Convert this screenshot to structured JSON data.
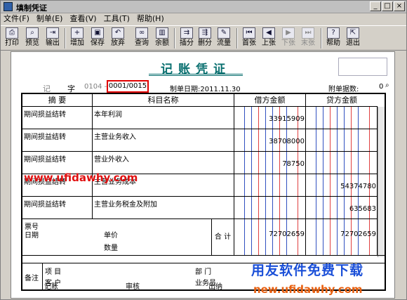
{
  "window": {
    "title": "填制凭证",
    "min": "_",
    "max": "□",
    "close": "×"
  },
  "menu": [
    "文件(F)",
    "制单(E)",
    "查看(V)",
    "工具(T)",
    "帮助(H)"
  ],
  "toolbar": {
    "print": "打印",
    "preview": "预览",
    "export": "输出",
    "add": "增加",
    "save": "保存",
    "discard": "放弃",
    "query": "查询",
    "balance": "余额",
    "insert_entry": "插分",
    "delete_entry": "删分",
    "flow": "流量",
    "first": "首张",
    "prev": "上张",
    "next": "下张",
    "last": "末张",
    "help": "帮助",
    "exit": "退出"
  },
  "voucher": {
    "title": "记账凭证",
    "type_label": "记",
    "zi_label": "字",
    "code": "0104 -",
    "number": "0001/0015",
    "date_label": "制单日期:2011.11.30",
    "attach_label": "附单据数:",
    "attach_value": "0",
    "headers": {
      "summary": "摘 要",
      "account": "科目名称",
      "debit": "借方金额",
      "credit": "贷方金额"
    },
    "rows": [
      {
        "summary": "期间损益结转",
        "account": "本年利润",
        "debit": "33915909",
        "credit": ""
      },
      {
        "summary": "期间损益结转",
        "account": "主营业务收入",
        "debit": "38708000",
        "credit": ""
      },
      {
        "summary": "期间损益结转",
        "account": "营业外收入",
        "debit": "78750",
        "credit": ""
      },
      {
        "summary": "期间损益结转",
        "account": "主营业务成本",
        "debit": "",
        "credit": "54374780"
      },
      {
        "summary": "期间损益结转",
        "account": "主营业务税金及附加",
        "debit": "",
        "credit": "635683"
      }
    ],
    "footer": {
      "ticket_no": "票号",
      "date": "日期",
      "unit_price": "单价",
      "quantity": "数量",
      "total_label": "合 计",
      "total_debit": "72702659",
      "total_credit": "72702659"
    },
    "remarks": {
      "label": "备注",
      "project": "项 目",
      "customer": "客 户",
      "department": "部 门",
      "salesman": "业务员"
    },
    "signatures": {
      "bookkeeper": "记账",
      "review": "审核",
      "cashier": "出纳"
    }
  },
  "watermarks": {
    "site1": "www.ufidawhy.com",
    "brand": "用友软件免费下载",
    "site2": "new.ufidawhy.com"
  },
  "colors": {
    "title": "#0a7070",
    "highlight": "#e00000"
  }
}
